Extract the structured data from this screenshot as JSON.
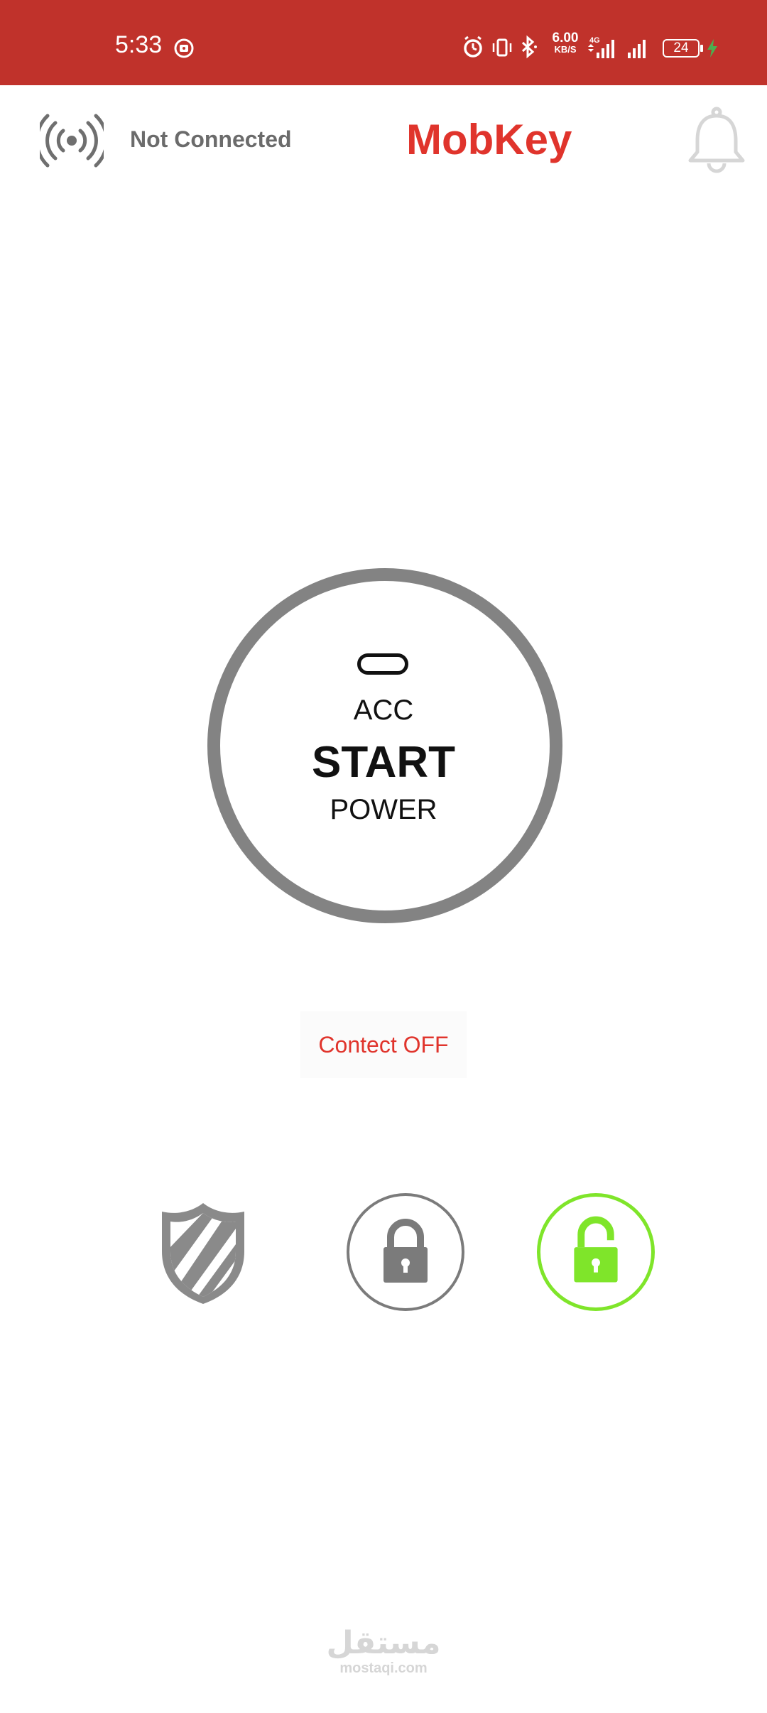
{
  "status_bar": {
    "time": "5:33",
    "net_speed_value": "6.00",
    "net_speed_unit": "KB/S",
    "network_type": "4G",
    "battery_level": "24",
    "icons": [
      "alarm-icon",
      "vibrate-icon",
      "bluetooth-icon",
      "signal-icon",
      "signal-icon",
      "battery-icon",
      "charging-icon"
    ],
    "background_color": "#c0322b"
  },
  "header": {
    "connection_status": "Not Connected",
    "app_title": "MobKey",
    "title_color": "#e0342c"
  },
  "ignition": {
    "acc_label": "ACC",
    "start_label": "START",
    "power_label": "POWER"
  },
  "contact_button": {
    "label": "Contect OFF"
  },
  "controls": {
    "icons": [
      "shield-icon",
      "lock-icon",
      "unlock-icon"
    ],
    "unlock_active_color": "#7fe52a"
  },
  "watermark": {
    "arabic": "مستقل",
    "latin": "mostaqi.com"
  }
}
